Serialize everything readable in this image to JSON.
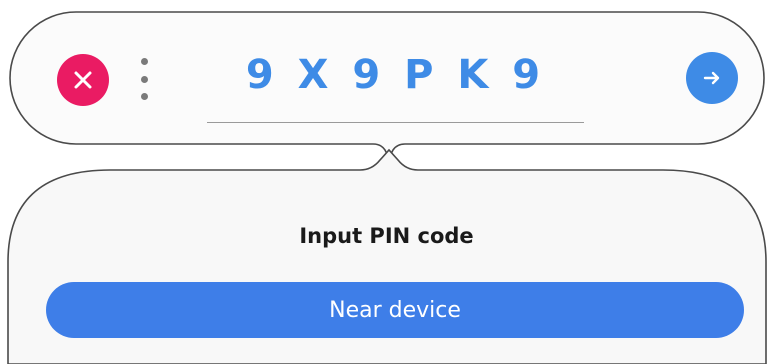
{
  "pin_bar": {
    "pin_code": "9 X 9 P K 9",
    "close_icon": "close-icon",
    "more_icon": "more-vertical-icon",
    "next_icon": "arrow-right-icon"
  },
  "prompt": {
    "title": "Input PIN code",
    "near_device_label": "Near device"
  },
  "colors": {
    "pin_text": "#3e8be6",
    "close_button": "#ea1b63",
    "next_button": "#3e8be6",
    "primary_button": "#3e7ee8"
  }
}
